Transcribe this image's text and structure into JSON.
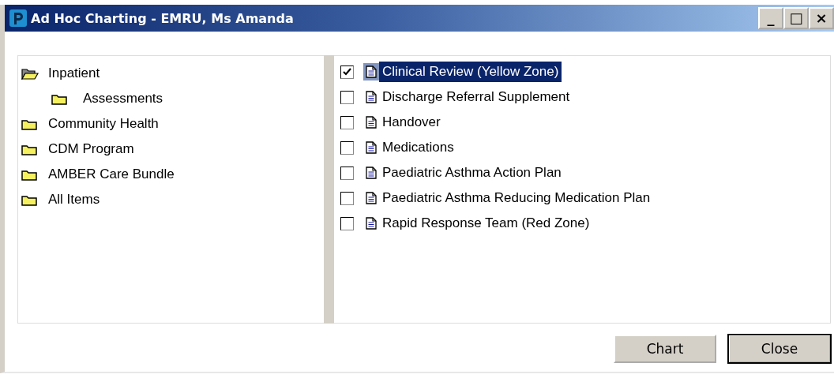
{
  "window": {
    "title": "Ad Hoc Charting - EMRU, Ms Amanda",
    "controls": [
      "_",
      "□",
      "×"
    ]
  },
  "tree": [
    {
      "label": "Inpatient",
      "expanded": true,
      "children": [
        {
          "label": "Assessments",
          "expanded": false
        }
      ]
    },
    {
      "label": "Community Health",
      "expanded": false
    },
    {
      "label": "CDM Program",
      "expanded": false
    },
    {
      "label": "AMBER Care Bundle",
      "expanded": false
    },
    {
      "label": "All Items",
      "expanded": false
    }
  ],
  "forms": [
    {
      "label": "Clinical Review (Yellow Zone)",
      "checked": true,
      "selected": true
    },
    {
      "label": "Discharge Referral Supplement",
      "checked": false,
      "selected": false
    },
    {
      "label": "Handover",
      "checked": false,
      "selected": false
    },
    {
      "label": "Medications",
      "checked": false,
      "selected": false
    },
    {
      "label": "Paediatric Asthma Action Plan",
      "checked": false,
      "selected": false
    },
    {
      "label": "Paediatric Asthma Reducing Medication Plan",
      "checked": false,
      "selected": false
    },
    {
      "label": "Rapid Response Team (Red Zone)",
      "checked": false,
      "selected": false
    }
  ],
  "buttons": [
    {
      "label": "Chart",
      "default": false
    },
    {
      "label": "Close",
      "default": true
    }
  ]
}
